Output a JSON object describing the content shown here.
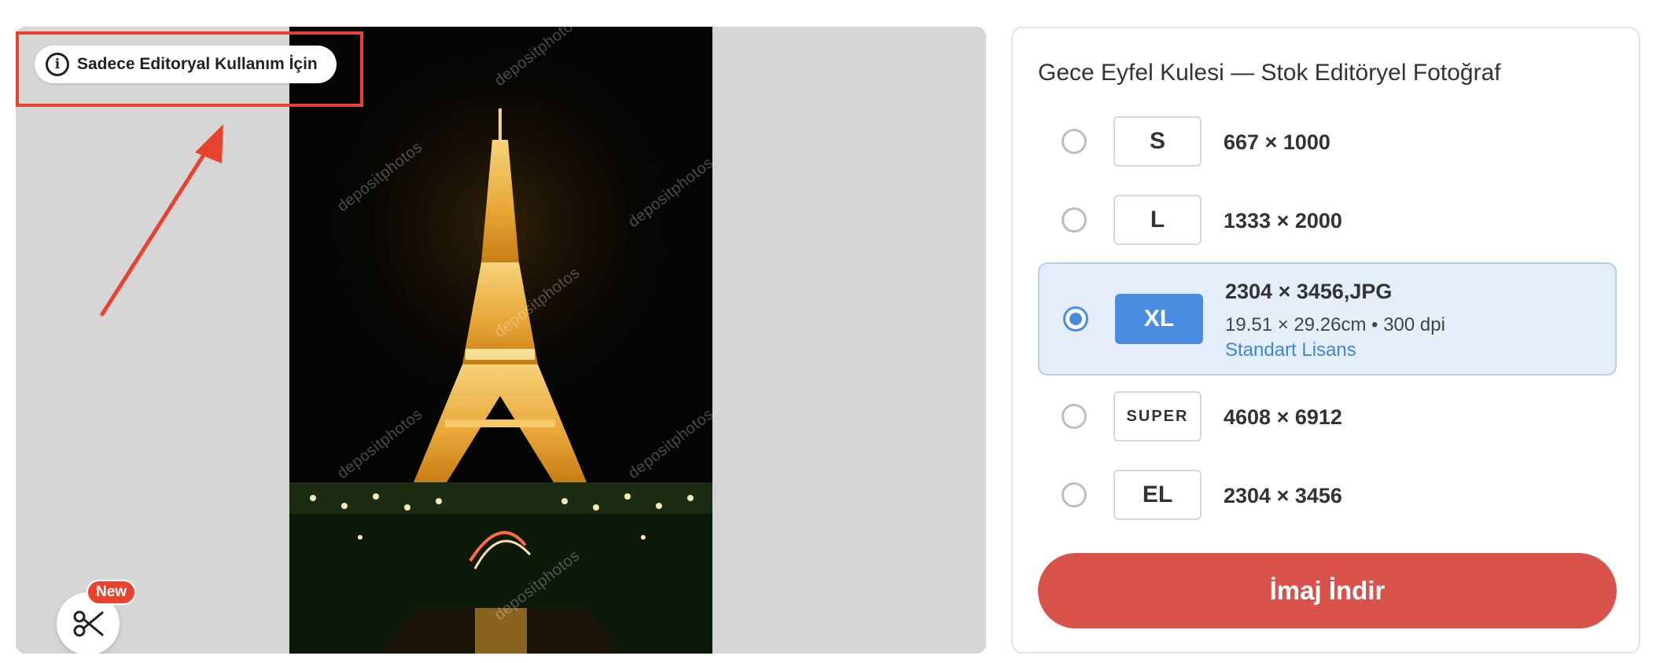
{
  "preview": {
    "editorial_badge": "Sadece Editoryal Kullanım İçin",
    "info_glyph": "i",
    "watermark": "depositphotos",
    "new_label": "New",
    "icons": [
      "info-icon",
      "scissors-icon"
    ],
    "annotation_color": "#e8432e"
  },
  "panel": {
    "title": "Gece Eyfel Kulesi — Stok Editöryel Fotoğraf",
    "options": [
      {
        "code": "S",
        "dims": "667 × 1000",
        "selected": false
      },
      {
        "code": "L",
        "dims": "1333 × 2000",
        "selected": false
      },
      {
        "code": "XL",
        "dims": "2304 × 3456,JPG",
        "meta": "19.51 × 29.26cm • 300 dpi",
        "license": "Standart Lisans",
        "selected": true
      },
      {
        "code": "SUPER",
        "dims": "4608 × 6912",
        "selected": false
      },
      {
        "code": "EL",
        "dims": "2304 × 3456",
        "selected": false
      }
    ],
    "download_label": "İmaj İndir",
    "colors": {
      "accent_blue": "#4a8de0",
      "download_red": "#d9534a"
    }
  }
}
